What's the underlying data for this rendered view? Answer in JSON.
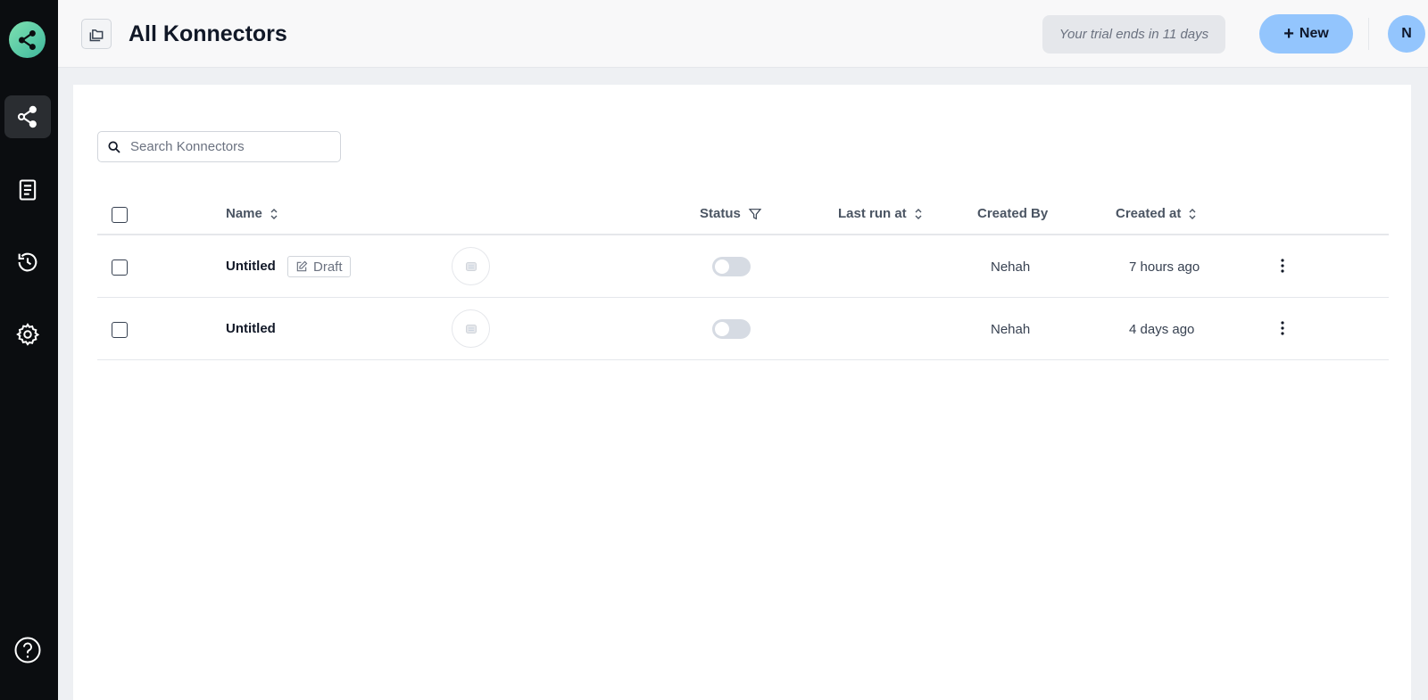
{
  "app": {
    "title": "All Konnectors"
  },
  "header": {
    "trial_text": "Your trial ends in 11 days",
    "new_label": "New",
    "avatar_initial": "N"
  },
  "sidebar": {
    "items": [
      {
        "icon": "share-icon",
        "active": true
      },
      {
        "icon": "document-icon",
        "active": false
      },
      {
        "icon": "history-icon",
        "active": false
      },
      {
        "icon": "gear-icon",
        "active": false
      }
    ],
    "help_icon": "help-icon"
  },
  "search": {
    "placeholder": "Search Konnectors",
    "value": ""
  },
  "table": {
    "columns": {
      "name": "Name",
      "status": "Status",
      "last_run_at": "Last run at",
      "created_by": "Created By",
      "created_at": "Created at"
    },
    "rows": [
      {
        "name": "Untitled",
        "badge": "Draft",
        "status_on": false,
        "last_run_at": "",
        "created_by": "Nehah",
        "created_at": "7 hours ago"
      },
      {
        "name": "Untitled",
        "badge": "",
        "status_on": false,
        "last_run_at": "",
        "created_by": "Nehah",
        "created_at": "4 days ago"
      }
    ]
  },
  "colors": {
    "sidebar_bg": "#0b0d10",
    "accent": "#93c5fd",
    "logo": "#58c9a6"
  }
}
